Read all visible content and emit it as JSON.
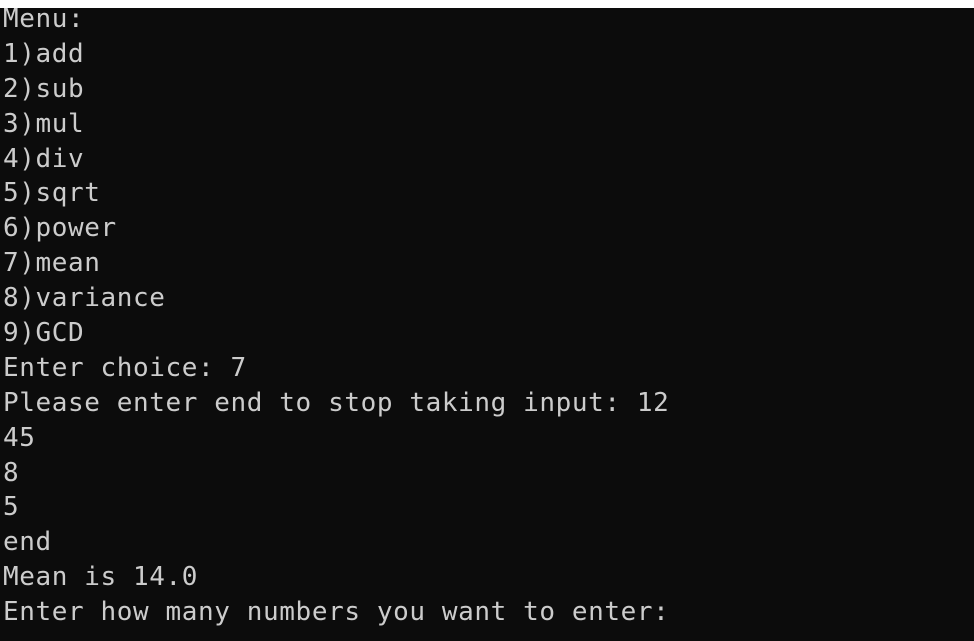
{
  "console": {
    "lines": [
      "Menu:",
      "1)add",
      "2)sub",
      "3)mul",
      "4)div",
      "5)sqrt",
      "6)power",
      "7)mean",
      "8)variance",
      "9)GCD",
      "Enter choice: 7",
      "Please enter end to stop taking input: 12",
      "45",
      "8",
      "5",
      "end",
      "Mean is 14.0",
      "Enter how many numbers you want to enter:"
    ]
  },
  "colors": {
    "background": "#0c0c0c",
    "text": "#cccccc"
  }
}
